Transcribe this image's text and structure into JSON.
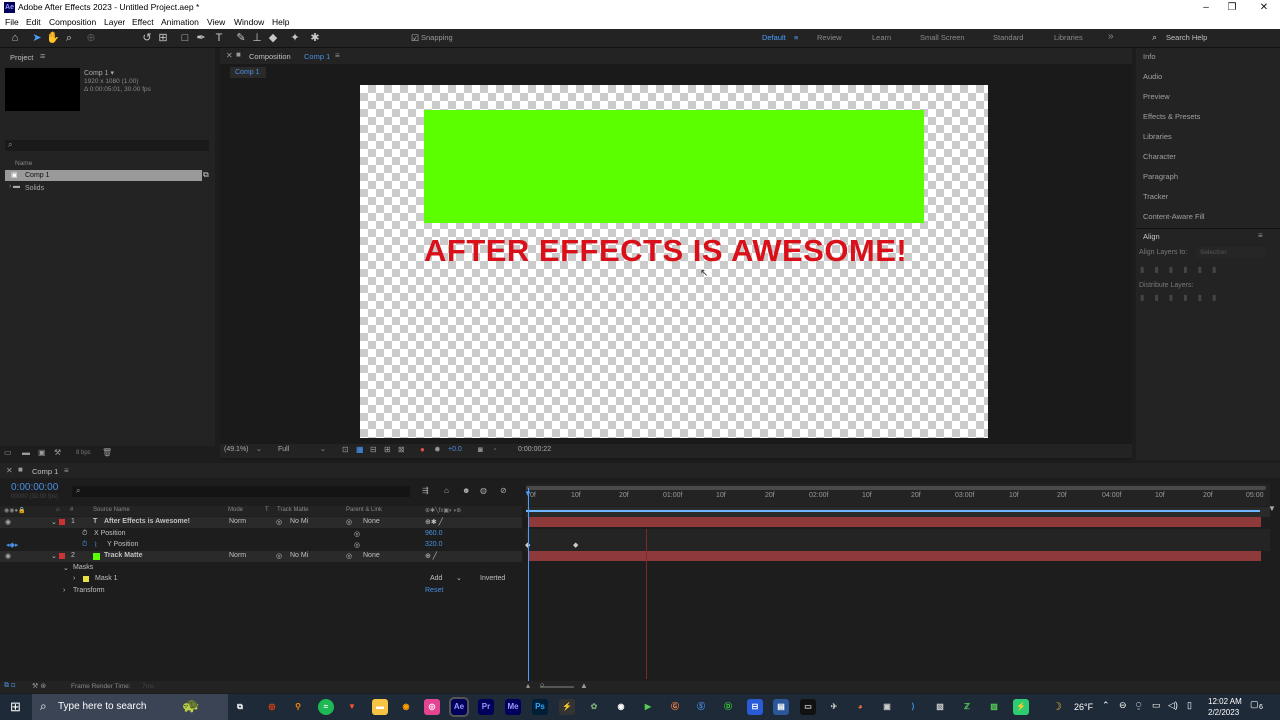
{
  "window": {
    "title": "Adobe After Effects 2023 - Untitled Project.aep *",
    "logo": "Ae",
    "min": "–",
    "max": "❐",
    "close": "✕"
  },
  "menu": [
    "File",
    "Edit",
    "Composition",
    "Layer",
    "Effect",
    "Animation",
    "View",
    "Window",
    "Help"
  ],
  "toolbar": {
    "snapping": "Snapping",
    "workspaces": [
      "Default",
      "Review",
      "Learn",
      "Small Screen",
      "Standard",
      "Libraries"
    ],
    "search": "Search Help"
  },
  "project": {
    "title": "Project",
    "comp_name": "Comp 1 ▾",
    "comp_size": "1920 x 1080 (1.00)",
    "comp_duration": "Δ 0:00:05:01, 30.00 fps",
    "col_name": "Name",
    "items": [
      "Comp 1",
      "Solids"
    ],
    "bpc": "8 bpc"
  },
  "composition": {
    "panel_label": "Composition",
    "comp_link": "Comp 1",
    "tab": "Comp 1",
    "headline": "AFTER EFFECTS IS AWESOME!",
    "zoom": "(49.1%)",
    "quality": "Full",
    "exposure": "+0.0",
    "timecode": "0:00:00:22"
  },
  "right_panel": [
    "Info",
    "Audio",
    "Preview",
    "Effects & Presets",
    "Libraries",
    "Character",
    "Paragraph",
    "Tracker",
    "Content-Aware Fill"
  ],
  "align": {
    "title": "Align",
    "align_to": "Align Layers to:",
    "align_to_value": "Selection",
    "distribute": "Distribute Layers:"
  },
  "timeline": {
    "tab": "Comp 1",
    "time": "0:00:00:00",
    "fps_info": "00000 (30.00 fps)",
    "headers": {
      "source": "Source Name",
      "mode": "Mode",
      "t": "T",
      "matte": "Track Matte",
      "parent": "Parent & Link"
    },
    "ruler": [
      "0f",
      "10f",
      "20f",
      "01:00f",
      "10f",
      "20f",
      "02:00f",
      "10f",
      "20f",
      "03:00f",
      "10f",
      "20f",
      "04:00f",
      "10f",
      "20f",
      "05:00"
    ],
    "layers": [
      {
        "num": "1",
        "name": "After Effects is Awesome!",
        "mode": "Norm",
        "matte": "No Mi",
        "parent": "None"
      },
      {
        "num": "2",
        "name": "Track Matte",
        "mode": "Norm",
        "matte": "No Mi",
        "parent": "None"
      }
    ],
    "props": {
      "x_pos": "X Position",
      "x_val": "960.0",
      "y_pos": "Y Position",
      "y_val": "320.0",
      "masks": "Masks",
      "mask1": "Mask 1",
      "mask_mode": "Add",
      "inverted": "Inverted",
      "transform": "Transform",
      "reset": "Reset"
    },
    "render_time": "Frame Render Time:",
    "render_val": "7ms"
  },
  "taskbar": {
    "search": "Type here to search",
    "temp": "26°F",
    "time": "12:02 AM",
    "date": "2/2/2023",
    "notif": "6"
  }
}
